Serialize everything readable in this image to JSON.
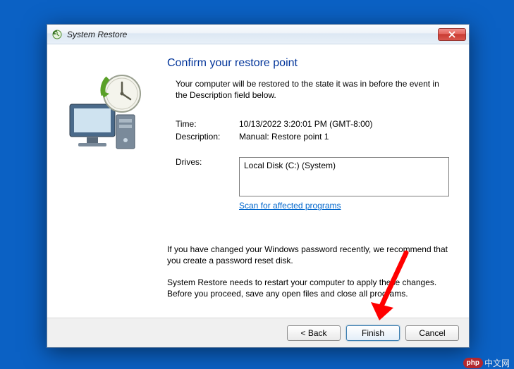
{
  "titlebar": {
    "title": "System Restore"
  },
  "heading": "Confirm your restore point",
  "intro": "Your computer will be restored to the state it was in before the event in the Description field below.",
  "fields": {
    "time_label": "Time:",
    "time_value": "10/13/2022 3:20:01 PM (GMT-8:00)",
    "description_label": "Description:",
    "description_value": "Manual: Restore point 1",
    "drives_label": "Drives:",
    "drives_value": "Local Disk (C:) (System)"
  },
  "scan_link": "Scan for affected programs",
  "warning1": "If you have changed your Windows password recently, we recommend that you create a password reset disk.",
  "warning2": "System Restore needs to restart your computer to apply these changes. Before you proceed, save any open files and close all programs.",
  "buttons": {
    "back": "< Back",
    "finish": "Finish",
    "cancel": "Cancel"
  },
  "watermark": {
    "badge": "php",
    "text": "中文网"
  }
}
